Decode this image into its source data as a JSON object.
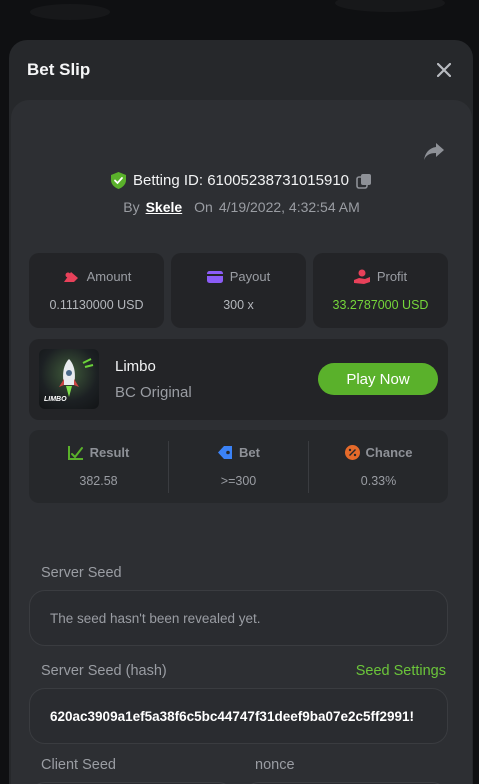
{
  "modal": {
    "title": "Bet Slip"
  },
  "bet": {
    "id_label": "Betting ID:",
    "id_value": "61005238731015910",
    "by_label": "By",
    "user": "Skele",
    "on_label": "On",
    "datetime": "4/19/2022, 4:32:54 AM"
  },
  "stats": [
    {
      "label": "Amount",
      "value": "0.11130000 USD",
      "icon": "amount-icon",
      "color": "#e8415a"
    },
    {
      "label": "Payout",
      "value": "300 x",
      "icon": "wallet-icon",
      "color": "#8b5cf6"
    },
    {
      "label": "Profit",
      "value": "33.2787000 USD",
      "icon": "profit-hand-icon",
      "color": "#e8415a"
    }
  ],
  "game": {
    "name": "Limbo",
    "provider": "BC Original",
    "thumb_text": "LIMBO",
    "play_label": "Play Now"
  },
  "result": [
    {
      "label": "Result",
      "value": "382.58",
      "icon": "check-chart-icon",
      "color": "#5ab12b"
    },
    {
      "label": "Bet",
      "value": ">=300",
      "icon": "tag-icon",
      "color": "#3b82f6"
    },
    {
      "label": "Chance",
      "value": "0.33%",
      "icon": "percent-icon",
      "color": "#e56a2a"
    }
  ],
  "server_seed": {
    "label": "Server Seed",
    "placeholder": "The seed hasn't been revealed yet."
  },
  "server_seed_hash": {
    "label": "Server Seed (hash)",
    "settings_link": "Seed Settings",
    "value": "620ac3909a1ef5a38f6c5bc44747f31deef9ba07e2c5ff2991!"
  },
  "client_seed": {
    "label": "Client Seed"
  },
  "nonce": {
    "label": "nonce"
  },
  "colors": {
    "accent_green": "#5ab12b",
    "link_green": "#6bc53a",
    "profit_green": "#75d63a"
  }
}
